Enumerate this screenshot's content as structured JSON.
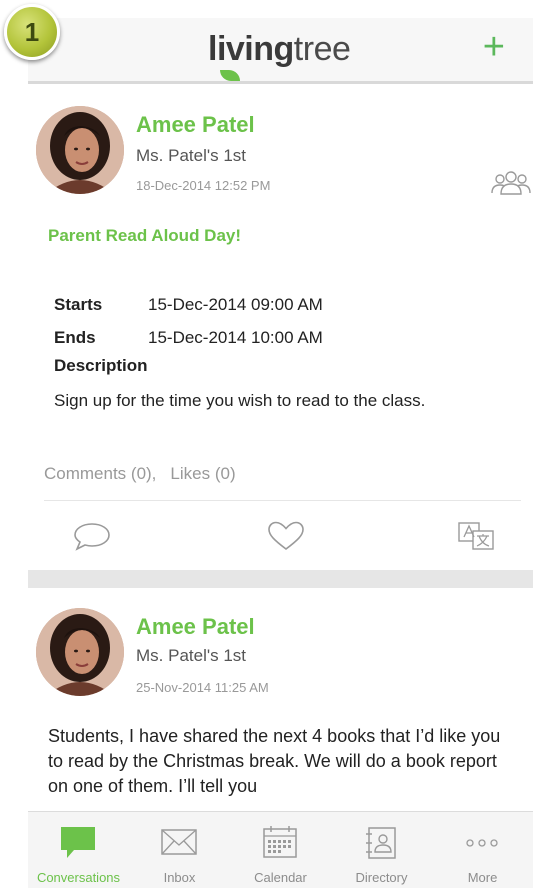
{
  "step_badge": "1",
  "header": {
    "logo_bold": "living",
    "logo_light": "tree",
    "add_label": "+"
  },
  "posts": [
    {
      "author": "Amee Patel",
      "class_name": "Ms. Patel's 1st",
      "timestamp": "18-Dec-2014 12:52 PM",
      "event_title": "Parent Read Aloud Day!",
      "starts_label": "Starts",
      "starts_value": "15-Dec-2014 09:00 AM",
      "ends_label": "Ends",
      "ends_value": "15-Dec-2014 10:00 AM",
      "description_label": "Description",
      "description": "Sign up for the time you wish to read to the class.",
      "comments": "Comments (0),",
      "likes": "Likes (0)"
    },
    {
      "author": "Amee Patel",
      "class_name": "Ms. Patel's 1st",
      "timestamp": "25-Nov-2014 11:25 AM",
      "text": "Students, I have shared the next 4 books that I’d like you to read by the Christmas break.  We will do a book report on one of them.  I’ll tell you"
    }
  ],
  "tabs": [
    {
      "label": "Conversations",
      "icon": "chat-bubble-icon",
      "active": true
    },
    {
      "label": "Inbox",
      "icon": "envelope-icon",
      "active": false
    },
    {
      "label": "Calendar",
      "icon": "calendar-icon",
      "active": false
    },
    {
      "label": "Directory",
      "icon": "address-book-icon",
      "active": false
    },
    {
      "label": "More",
      "icon": "more-dots-icon",
      "active": false
    }
  ],
  "colors": {
    "accent": "#6cc24a",
    "badge": "#b3c43a",
    "muted": "#999999"
  }
}
